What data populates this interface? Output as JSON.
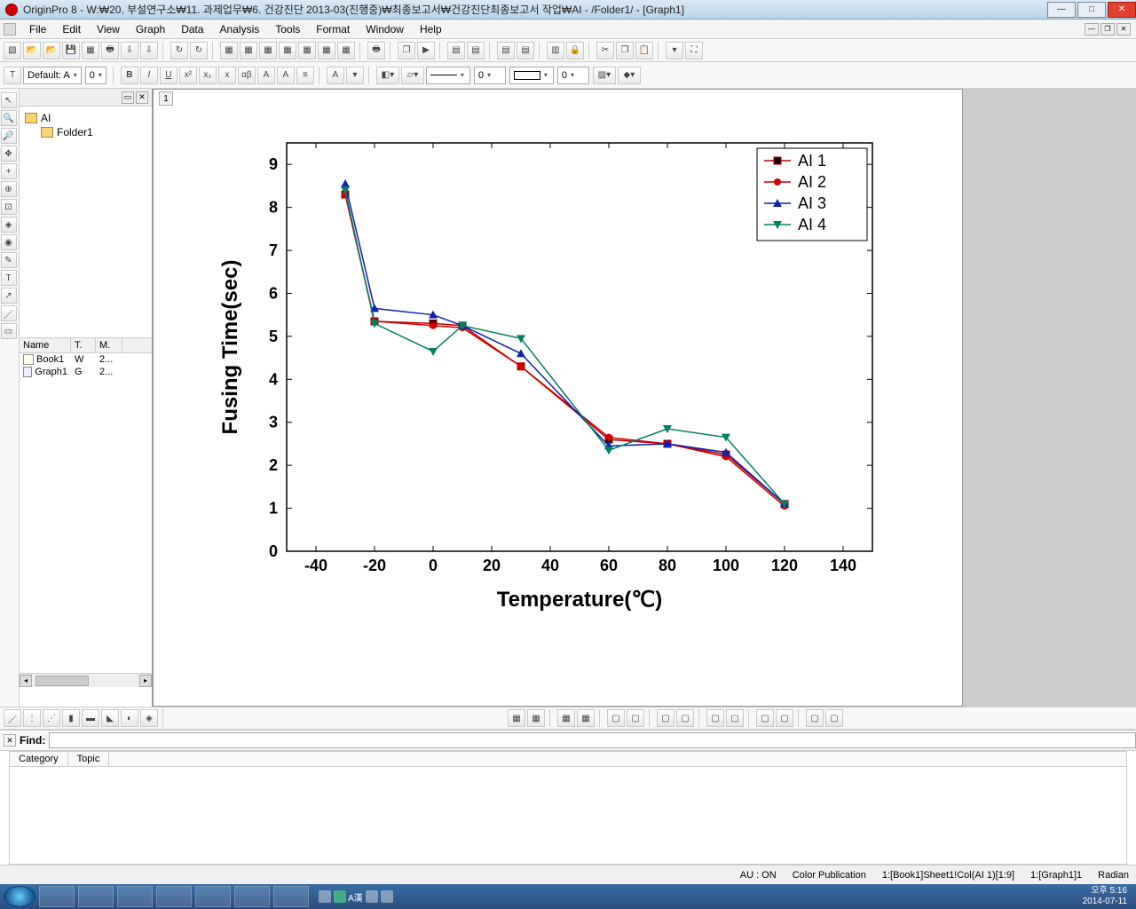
{
  "title": "OriginPro 8 - W:₩20. 부설연구소₩11. 과제업무₩6. 건강진단 2013-03(진행중)₩최종보고서₩건강진단최종보고서 작업₩AI - /Folder1/ - [Graph1]",
  "menu": [
    "File",
    "Edit",
    "View",
    "Graph",
    "Data",
    "Analysis",
    "Tools",
    "Format",
    "Window",
    "Help"
  ],
  "font_label": "Default: A",
  "font_size": "0",
  "line_width": "0",
  "explorer": {
    "root": "AI",
    "child": "Folder1",
    "columns": [
      "Name",
      "T.",
      "M."
    ],
    "items": [
      {
        "name": "Book1",
        "t": "W",
        "m": "2..."
      },
      {
        "name": "Graph1",
        "t": "G",
        "m": "2..."
      }
    ]
  },
  "graph_tab": "1",
  "find_label": "Find:",
  "cat_tabs": [
    "Category",
    "Topic"
  ],
  "status": {
    "au": "AU : ON",
    "color": "Color Publication",
    "sel": "1:[Book1]Sheet1!Col(AI 1)[1:9]",
    "win": "1:[Graph1]1",
    "angle": "Radian"
  },
  "clock": {
    "time": "오후 5:16",
    "date": "2014-07-11"
  },
  "ime": "A漢",
  "chart_data": {
    "type": "line",
    "xlabel": "Temperature(℃)",
    "ylabel": "Fusing Time(sec)",
    "xlim": [
      -50,
      150
    ],
    "ylim": [
      0,
      9.5
    ],
    "xticks": [
      -40,
      -20,
      0,
      20,
      40,
      60,
      80,
      100,
      120,
      140
    ],
    "yticks": [
      0,
      1,
      2,
      3,
      4,
      5,
      6,
      7,
      8,
      9
    ],
    "x": [
      -30,
      -20,
      0,
      10,
      30,
      60,
      80,
      100,
      120
    ],
    "series": [
      {
        "name": "AI 1",
        "color": "#c00000",
        "marker": "square-black",
        "values": [
          8.3,
          5.35,
          5.3,
          5.25,
          4.3,
          2.6,
          2.5,
          2.25,
          1.1
        ]
      },
      {
        "name": "AI 2",
        "color": "#d00000",
        "marker": "circle-red",
        "values": [
          8.3,
          5.35,
          5.25,
          5.2,
          4.3,
          2.65,
          2.5,
          2.2,
          1.05
        ]
      },
      {
        "name": "AI 3",
        "color": "#1020b0",
        "marker": "triangle-blue",
        "values": [
          8.55,
          5.65,
          5.5,
          5.25,
          4.6,
          2.45,
          2.5,
          2.3,
          1.1
        ]
      },
      {
        "name": "AI 4",
        "color": "#008060",
        "marker": "triangle-down-teal",
        "values": [
          8.4,
          5.3,
          4.65,
          5.25,
          4.95,
          2.35,
          2.85,
          2.65,
          1.1
        ]
      }
    ]
  }
}
